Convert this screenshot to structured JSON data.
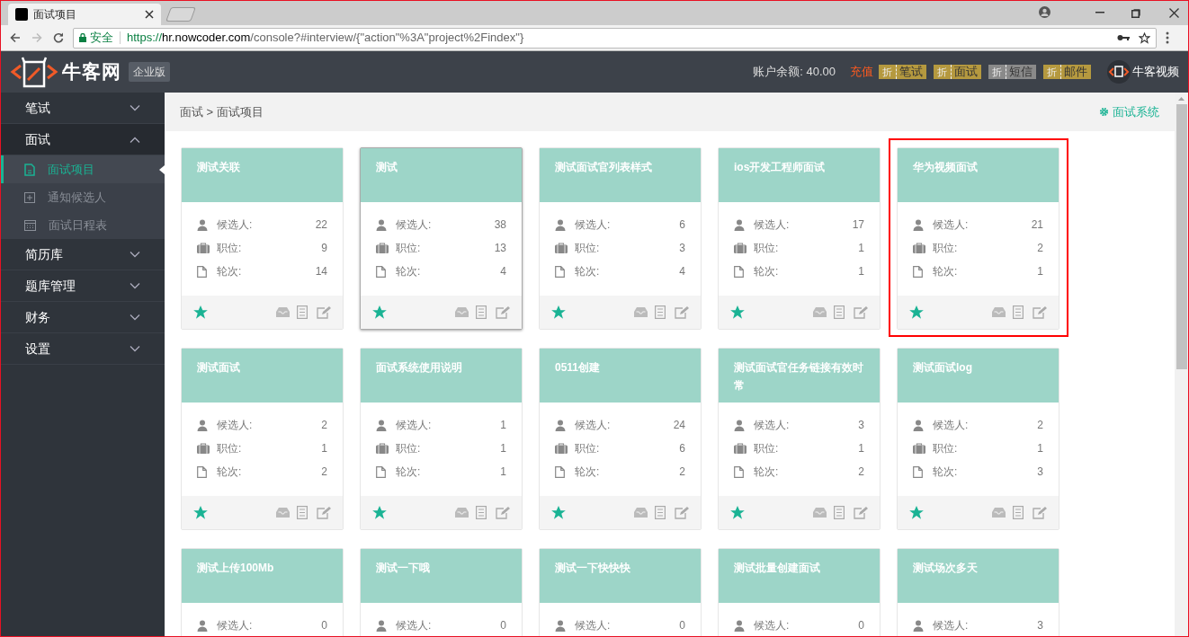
{
  "browser": {
    "tab_title": "面试项目",
    "secure_label": "安全",
    "url_scheme": "https://",
    "url_host": "hr.nowcoder.com",
    "url_path": "/console?#interview/{\"action\"%3A\"project%2Findex\"}"
  },
  "header": {
    "logo_text": "牛客网",
    "edition": "企业版",
    "balance": "账户余额: 40.00",
    "recharge": "充值",
    "badges": [
      {
        "tag": "折",
        "label": "笔试",
        "color": "#b5993f"
      },
      {
        "tag": "折",
        "label": "面试",
        "color": "#b5993f"
      },
      {
        "tag": "折",
        "label": "短信",
        "color": "#8a8a8a"
      },
      {
        "tag": "折",
        "label": "邮件",
        "color": "#b5993f"
      }
    ],
    "video_label": "牛客视频"
  },
  "sidebar": {
    "items": [
      {
        "label": "笔试",
        "expanded": false
      },
      {
        "label": "面试",
        "expanded": true,
        "children": [
          {
            "label": "面试项目",
            "kind": "doc",
            "selected": true
          },
          {
            "label": "通知候选人",
            "kind": "plus",
            "selected": false
          },
          {
            "label": "面试日程表",
            "kind": "calendar",
            "selected": false
          }
        ]
      },
      {
        "label": "简历库",
        "expanded": false
      },
      {
        "label": "题库管理",
        "expanded": false
      },
      {
        "label": "财务",
        "expanded": false
      },
      {
        "label": "设置",
        "expanded": false
      }
    ]
  },
  "breadcrumb": "面试 > 面试项目",
  "system_link": "面试系统",
  "cards": [
    {
      "title": "测试关联",
      "hovered": false,
      "highlighted": false,
      "stats": [
        {
          "kind": "person",
          "label": "候选人:",
          "value": "22"
        },
        {
          "kind": "briefcase",
          "label": "职位:",
          "value": "9"
        },
        {
          "kind": "file",
          "label": "轮次:",
          "value": "14"
        }
      ]
    },
    {
      "title": "测试",
      "hovered": true,
      "highlighted": false,
      "stats": [
        {
          "kind": "person",
          "label": "候选人:",
          "value": "38"
        },
        {
          "kind": "briefcase",
          "label": "职位:",
          "value": "13"
        },
        {
          "kind": "file",
          "label": "轮次:",
          "value": "4"
        }
      ]
    },
    {
      "title": "测试面试官列表样式",
      "hovered": false,
      "highlighted": false,
      "stats": [
        {
          "kind": "person",
          "label": "候选人:",
          "value": "6"
        },
        {
          "kind": "briefcase",
          "label": "职位:",
          "value": "3"
        },
        {
          "kind": "file",
          "label": "轮次:",
          "value": "4"
        }
      ]
    },
    {
      "title": "ios开发工程师面试",
      "hovered": false,
      "highlighted": false,
      "stats": [
        {
          "kind": "person",
          "label": "候选人:",
          "value": "17"
        },
        {
          "kind": "briefcase",
          "label": "职位:",
          "value": "1"
        },
        {
          "kind": "file",
          "label": "轮次:",
          "value": "1"
        }
      ]
    },
    {
      "title": "华为视频面试",
      "hovered": false,
      "highlighted": true,
      "stats": [
        {
          "kind": "person",
          "label": "候选人:",
          "value": "21"
        },
        {
          "kind": "briefcase",
          "label": "职位:",
          "value": "2"
        },
        {
          "kind": "file",
          "label": "轮次:",
          "value": "1"
        }
      ]
    },
    {
      "title": "测试面试",
      "hovered": false,
      "highlighted": false,
      "stats": [
        {
          "kind": "person",
          "label": "候选人:",
          "value": "2"
        },
        {
          "kind": "briefcase",
          "label": "职位:",
          "value": "1"
        },
        {
          "kind": "file",
          "label": "轮次:",
          "value": "2"
        }
      ]
    },
    {
      "title": "面试系统使用说明",
      "hovered": false,
      "highlighted": false,
      "stats": [
        {
          "kind": "person",
          "label": "候选人:",
          "value": "1"
        },
        {
          "kind": "briefcase",
          "label": "职位:",
          "value": "1"
        },
        {
          "kind": "file",
          "label": "轮次:",
          "value": "1"
        }
      ]
    },
    {
      "title": "0511创建",
      "hovered": false,
      "highlighted": false,
      "stats": [
        {
          "kind": "person",
          "label": "候选人:",
          "value": "24"
        },
        {
          "kind": "briefcase",
          "label": "职位:",
          "value": "6"
        },
        {
          "kind": "file",
          "label": "轮次:",
          "value": "2"
        }
      ]
    },
    {
      "title": "测试面试官任务链接有效时常",
      "hovered": false,
      "highlighted": false,
      "stats": [
        {
          "kind": "person",
          "label": "候选人:",
          "value": "3"
        },
        {
          "kind": "briefcase",
          "label": "职位:",
          "value": "1"
        },
        {
          "kind": "file",
          "label": "轮次:",
          "value": "2"
        }
      ]
    },
    {
      "title": "测试面试log",
      "hovered": false,
      "highlighted": false,
      "stats": [
        {
          "kind": "person",
          "label": "候选人:",
          "value": "2"
        },
        {
          "kind": "briefcase",
          "label": "职位:",
          "value": "1"
        },
        {
          "kind": "file",
          "label": "轮次:",
          "value": "3"
        }
      ]
    },
    {
      "title": "测试上传100Mb",
      "hovered": false,
      "highlighted": false,
      "stats": [
        {
          "kind": "person",
          "label": "候选人:",
          "value": "0"
        }
      ]
    },
    {
      "title": "测试一下哦",
      "hovered": false,
      "highlighted": false,
      "stats": [
        {
          "kind": "person",
          "label": "候选人:",
          "value": "0"
        }
      ]
    },
    {
      "title": "测试一下快快快",
      "hovered": false,
      "highlighted": false,
      "stats": [
        {
          "kind": "person",
          "label": "候选人:",
          "value": "0"
        }
      ]
    },
    {
      "title": "测试批量创建面试",
      "hovered": false,
      "highlighted": false,
      "stats": [
        {
          "kind": "person",
          "label": "候选人:",
          "value": "0"
        }
      ]
    },
    {
      "title": "测试场次多天",
      "hovered": false,
      "highlighted": false,
      "stats": [
        {
          "kind": "person",
          "label": "候选人:",
          "value": "3"
        }
      ]
    }
  ]
}
